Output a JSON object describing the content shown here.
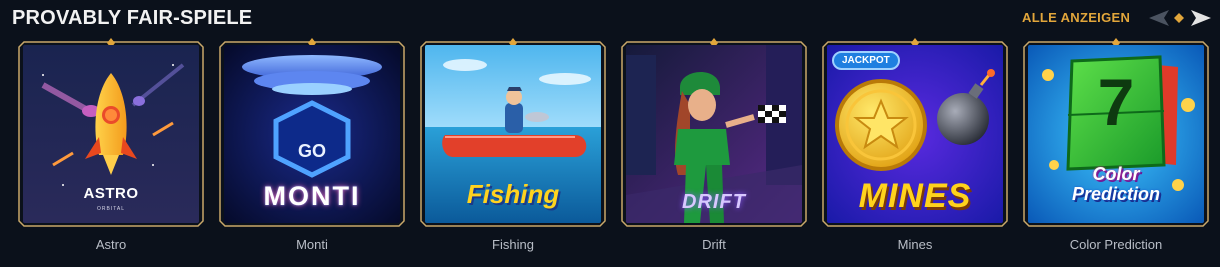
{
  "section": {
    "title": "PROVABLY FAIR-SPIELE",
    "view_all_label": "ALLE ANZEIGEN"
  },
  "icons": {
    "prev": "arrow-left-icon",
    "next": "arrow-right-icon",
    "frame_ornament": "diamond-ornament-icon"
  },
  "colors": {
    "background": "#0b111b",
    "accent_gold": "#e2a63b",
    "frame_border": "#c9a86a"
  },
  "games": [
    {
      "name": "Astro",
      "art_title": "ASTRO",
      "art_subtitle": "ORBITAL"
    },
    {
      "name": "Monti",
      "art_title": "MONTI",
      "art_subtitle": "GO"
    },
    {
      "name": "Fishing",
      "art_title": "Fishing"
    },
    {
      "name": "Drift",
      "art_title": "DRIFT"
    },
    {
      "name": "Mines",
      "art_title": "MINES",
      "badge": "JACKPOT"
    },
    {
      "name": "Color Prediction",
      "art_title_line1": "Color",
      "art_title_line2": "Prediction",
      "art_number": "7"
    }
  ]
}
